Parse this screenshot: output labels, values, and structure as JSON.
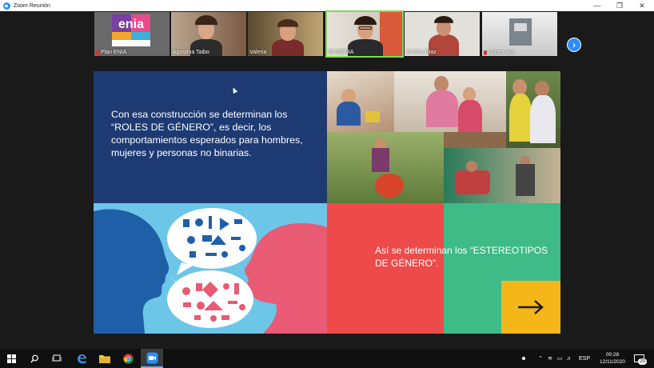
{
  "window": {
    "title": "Zoom Reunión"
  },
  "participants": [
    {
      "name": "Plan ENIA",
      "muted": true
    },
    {
      "name": "Agustina Taibo",
      "muted": false
    },
    {
      "name": "Valeria",
      "muted": false
    },
    {
      "name": "EUGENIA",
      "muted": false,
      "active_speaker": true
    },
    {
      "name": "Cinthia Diaz",
      "muted": false
    },
    {
      "name": "Lopez ana",
      "muted": true
    }
  ],
  "logo_text": "enia",
  "slide": {
    "roles_text": "Con esa construcción se determinan los “ROLES DE GÉNERO”, es decir, los comportamientos esperados para hombres, mujeres y personas no binarias.",
    "stereo_text": "Así se determinan los “ESTEREOTIPOS DE GÉNERO”."
  },
  "taskbar": {
    "language": "ESP",
    "time": "00:28",
    "date": "12/11/2020",
    "notifications": "20"
  },
  "colors": {
    "slide_navy": "#1e3a73",
    "slide_sky": "#6cc6e8",
    "slide_red": "#ee4a4a",
    "slide_green": "#3ebb87",
    "slide_yellow": "#f5b619",
    "zoom_blue": "#2d8cff"
  }
}
